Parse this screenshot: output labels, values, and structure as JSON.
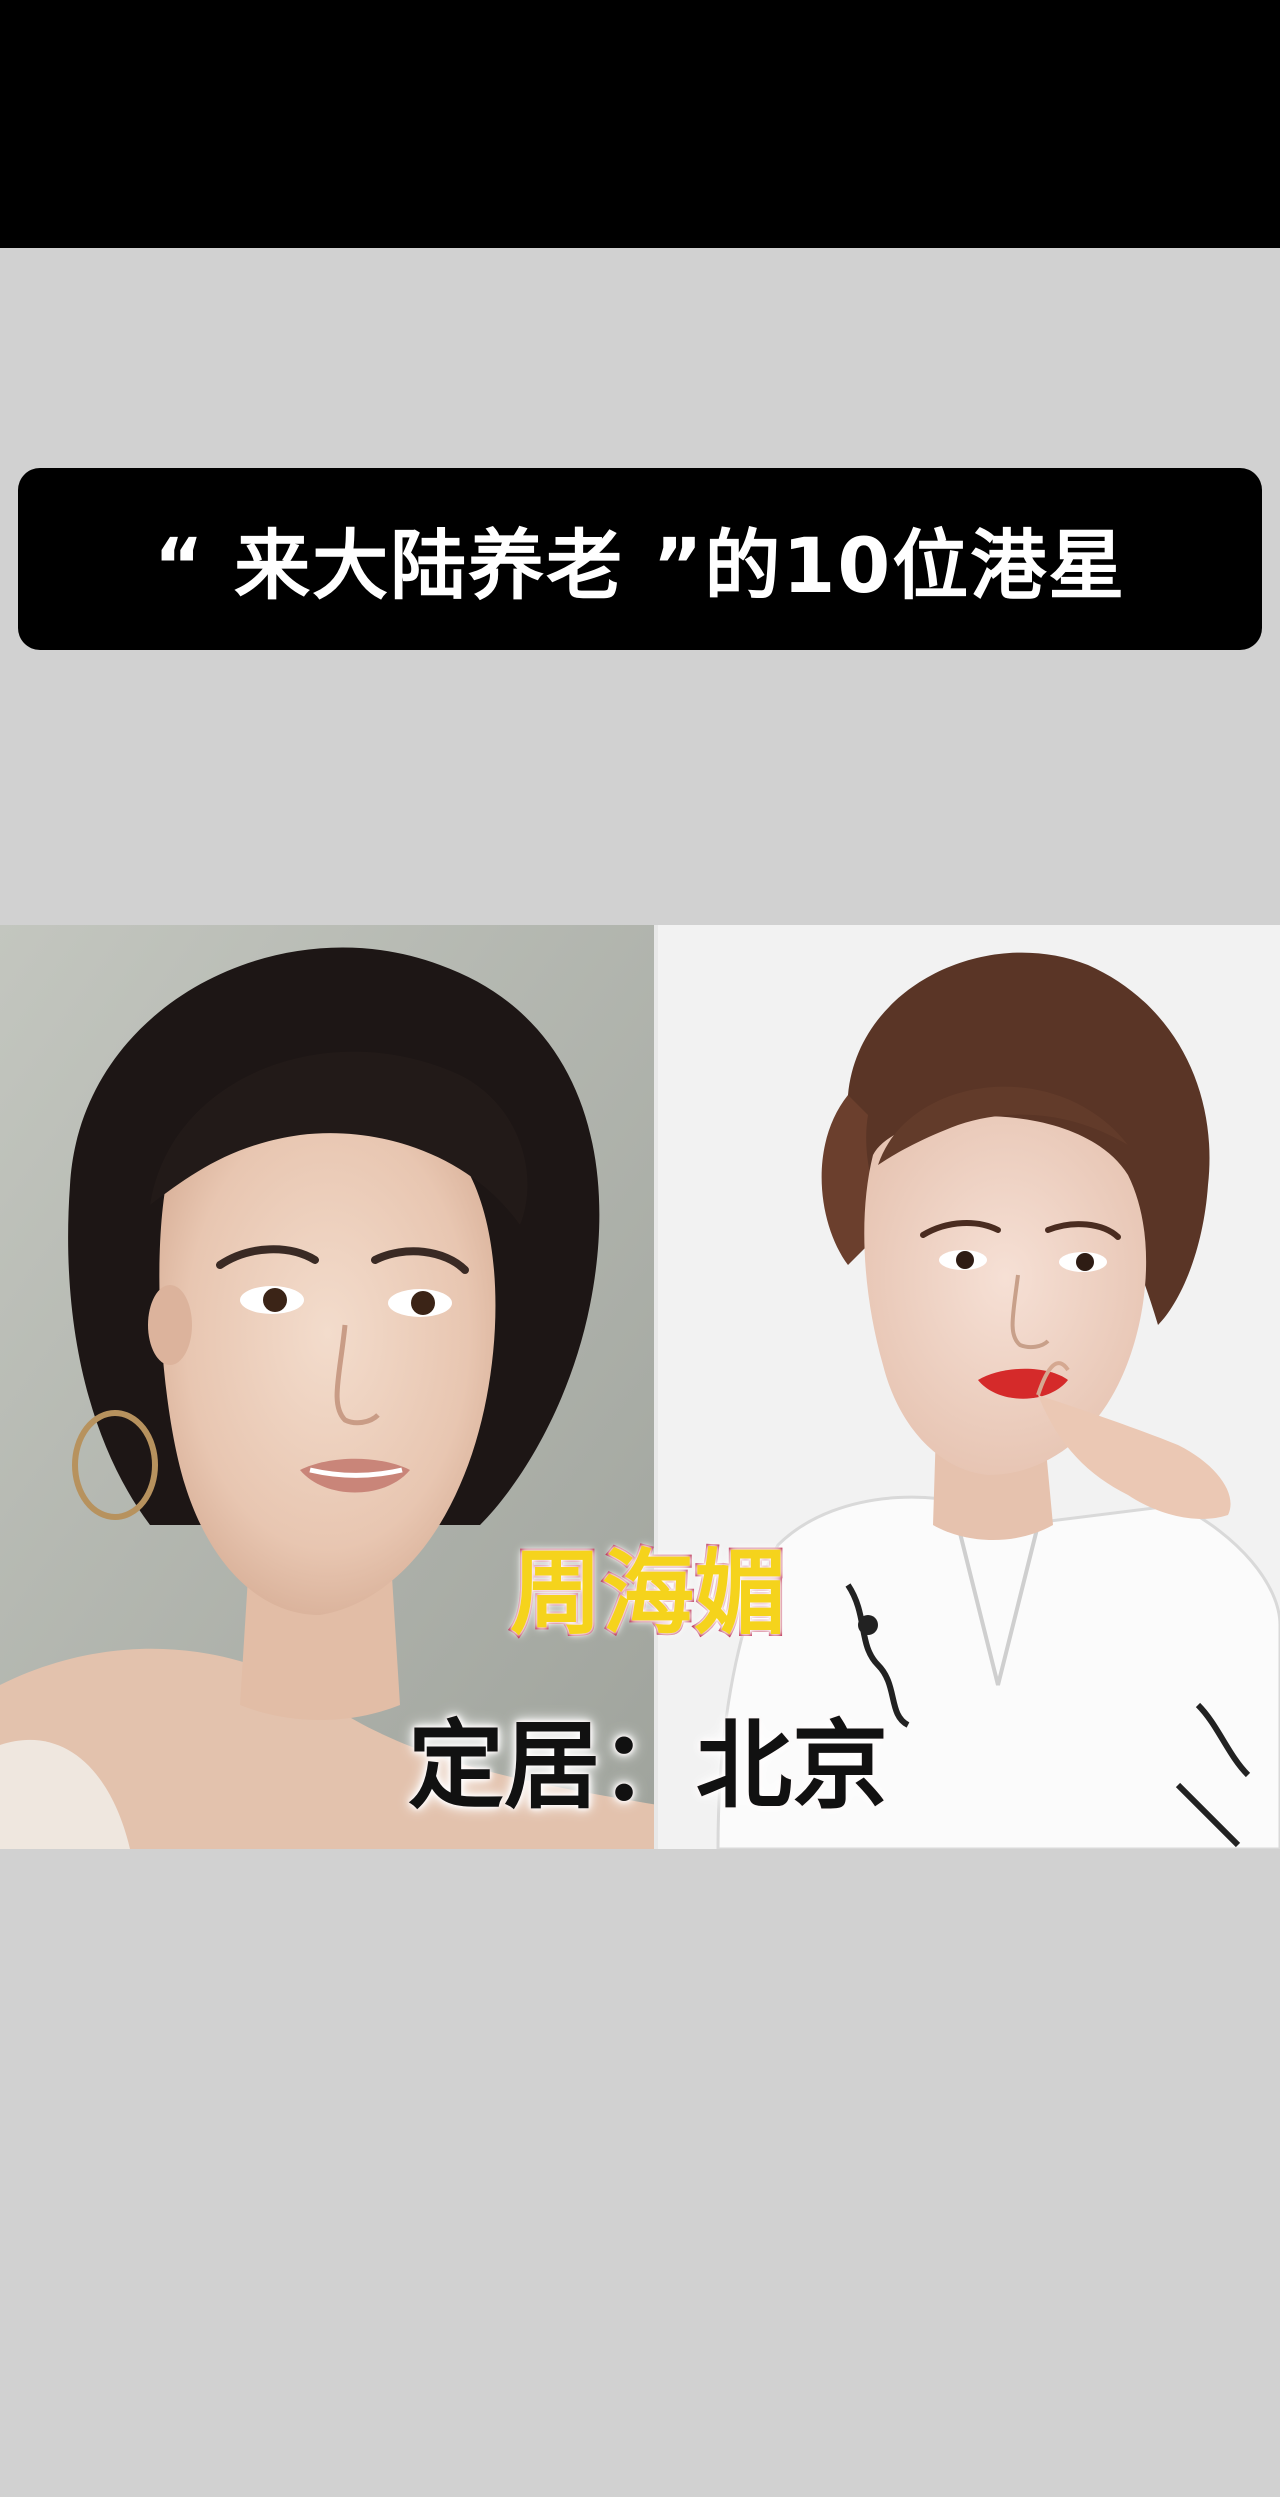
{
  "title": {
    "text": "“ 来大陆养老 ”的10位港星"
  },
  "photo": {
    "left_image": "portrait-woman-updo-hoop-earring",
    "right_image": "portrait-woman-short-curly-hair-white-shirt"
  },
  "caption": {
    "name": "周海媚",
    "location": "定居：北京"
  },
  "colors": {
    "background": "#d1d1d1",
    "top_bar": "#000000",
    "banner": "#000000",
    "banner_text": "#ffffff",
    "name_fill": "#f5d31c",
    "name_outline": "#b3123a",
    "location_text": "#111111"
  }
}
